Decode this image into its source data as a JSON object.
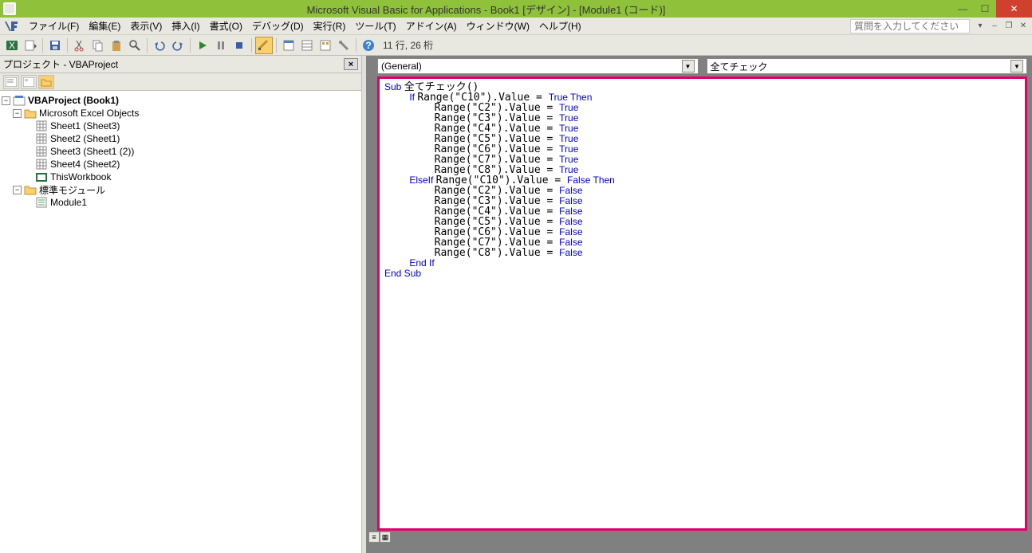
{
  "titlebar": {
    "title": "Microsoft Visual Basic for Applications - Book1 [デザイン] - [Module1 (コード)]"
  },
  "menu": {
    "file": "ファイル(F)",
    "edit": "編集(E)",
    "view": "表示(V)",
    "insert": "挿入(I)",
    "format": "書式(O)",
    "debug": "デバッグ(D)",
    "run": "実行(R)",
    "tools": "ツール(T)",
    "addin": "アドイン(A)",
    "window": "ウィンドウ(W)",
    "help": "ヘルプ(H)",
    "help_placeholder": "質問を入力してください"
  },
  "toolbar": {
    "position": "11 行, 26 桁"
  },
  "project_panel": {
    "title": "プロジェクト - VBAProject",
    "root": "VBAProject (Book1)",
    "folder1": "Microsoft Excel Objects",
    "sheets": [
      "Sheet1 (Sheet3)",
      "Sheet2 (Sheet1)",
      "Sheet3 (Sheet1 (2))",
      "Sheet4 (Sheet2)",
      "ThisWorkbook"
    ],
    "folder2": "標準モジュール",
    "module": "Module1"
  },
  "code_combos": {
    "left": "(General)",
    "right": "全てチェック"
  },
  "code_lines": [
    {
      "indent": 0,
      "parts": [
        {
          "t": "Sub ",
          "k": true
        },
        {
          "t": "全てチェック()"
        }
      ]
    },
    {
      "indent": 1,
      "parts": [
        {
          "t": "If ",
          "k": true
        },
        {
          "t": "Range(\"C10\").Value = "
        },
        {
          "t": "True Then",
          "k": true
        }
      ]
    },
    {
      "indent": 2,
      "parts": [
        {
          "t": "Range(\"C2\").Value = "
        },
        {
          "t": "True",
          "k": true
        }
      ]
    },
    {
      "indent": 2,
      "parts": [
        {
          "t": "Range(\"C3\").Value = "
        },
        {
          "t": "True",
          "k": true
        }
      ]
    },
    {
      "indent": 2,
      "parts": [
        {
          "t": "Range(\"C4\").Value = "
        },
        {
          "t": "True",
          "k": true
        }
      ]
    },
    {
      "indent": 2,
      "parts": [
        {
          "t": "Range(\"C5\").Value = "
        },
        {
          "t": "True",
          "k": true
        }
      ]
    },
    {
      "indent": 2,
      "parts": [
        {
          "t": "Range(\"C6\").Value = "
        },
        {
          "t": "True",
          "k": true
        }
      ]
    },
    {
      "indent": 2,
      "parts": [
        {
          "t": "Range(\"C7\").Value = "
        },
        {
          "t": "True",
          "k": true
        }
      ]
    },
    {
      "indent": 2,
      "parts": [
        {
          "t": "Range(\"C8\").Value = "
        },
        {
          "t": "True",
          "k": true
        }
      ]
    },
    {
      "indent": 1,
      "parts": [
        {
          "t": "ElseIf ",
          "k": true
        },
        {
          "t": "Range(\"C10\").Value = "
        },
        {
          "t": "False Then",
          "k": true
        }
      ]
    },
    {
      "indent": 2,
      "parts": [
        {
          "t": "Range(\"C2\").Value = "
        },
        {
          "t": "False",
          "k": true
        }
      ]
    },
    {
      "indent": 2,
      "parts": [
        {
          "t": "Range(\"C3\").Value = "
        },
        {
          "t": "False",
          "k": true
        }
      ]
    },
    {
      "indent": 2,
      "parts": [
        {
          "t": "Range(\"C4\").Value = "
        },
        {
          "t": "False",
          "k": true
        }
      ]
    },
    {
      "indent": 2,
      "parts": [
        {
          "t": "Range(\"C5\").Value = "
        },
        {
          "t": "False",
          "k": true
        }
      ]
    },
    {
      "indent": 2,
      "parts": [
        {
          "t": "Range(\"C6\").Value = "
        },
        {
          "t": "False",
          "k": true
        }
      ]
    },
    {
      "indent": 2,
      "parts": [
        {
          "t": "Range(\"C7\").Value = "
        },
        {
          "t": "False",
          "k": true
        }
      ]
    },
    {
      "indent": 2,
      "parts": [
        {
          "t": "Range(\"C8\").Value = "
        },
        {
          "t": "False",
          "k": true
        }
      ]
    },
    {
      "indent": 1,
      "parts": [
        {
          "t": "End If",
          "k": true
        }
      ]
    },
    {
      "indent": 0,
      "parts": [
        {
          "t": "End Sub",
          "k": true
        }
      ]
    }
  ]
}
